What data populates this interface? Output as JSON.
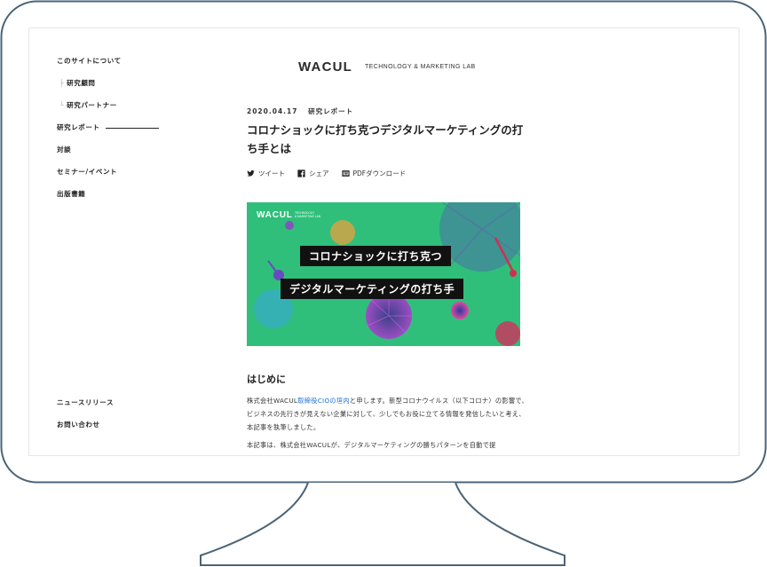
{
  "sidebar": {
    "items": [
      {
        "label": "このサイトについて"
      },
      {
        "label": "研究顧問",
        "tree": "├"
      },
      {
        "label": "研究パートナー",
        "tree": "└"
      },
      {
        "label": "研究レポート",
        "active": true
      },
      {
        "label": "対談"
      },
      {
        "label": "セミナー/イベント"
      },
      {
        "label": "出版書籍"
      }
    ],
    "footer_items": [
      {
        "label": "ニュースリリース"
      },
      {
        "label": "お問い合わせ"
      }
    ]
  },
  "header": {
    "logo": "WACUL",
    "tagline": "TECHNOLOGY & MARKETING LAB"
  },
  "article": {
    "date": "2020.04.17",
    "category": "研究レポート",
    "title": "コロナショックに打ち克つデジタルマーケティングの打ち手とは",
    "share": {
      "tweet": "ツイート",
      "share": "シェア",
      "pdf": "PDFダウンロード"
    },
    "hero": {
      "logo": "WACUL",
      "logo_sub_1": "TECHNOLOGY",
      "logo_sub_2": "& MARKETING LAB",
      "line1": "コロナショックに打ち克つ",
      "line2": "デジタルマーケティングの打ち手",
      "bg_color": "#2fbf7a"
    },
    "section_heading": "はじめに",
    "p1_before": "株式会社WACUL",
    "p1_link": "取締役CIOの垣内",
    "p1_after": "と申します。新型コロナウイルス（以下コロナ）の影響で、ビジネスの先行きが見えない企業に対して、少しでもお役に立てる情報を発信したいと考え、本記事を執筆しました。",
    "p2": "本記事は、株式会社WACULが、デジタルマーケティングの勝ちパターンを自動で提"
  },
  "colors": {
    "frame_stroke": "#4a6478",
    "link": "#1a6fd8"
  }
}
